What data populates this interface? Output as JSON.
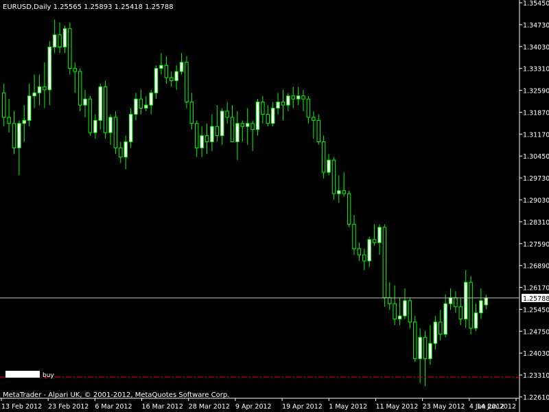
{
  "window": {
    "symbol_info": "EURUSD,Daily  1.25565 1.25893 1.25418 1.25788",
    "copyright": "MetaTrader - Alpari UK, © 2001-2012, MetaQuotes Software Corp."
  },
  "colors": {
    "background": "#000000",
    "bull_candle": "#ffffff",
    "bear_candle": "#000000",
    "candle_wick": "#00ff00",
    "price_line": "#c0c0c0",
    "order_line": "#ff0000",
    "axis": "#ffffff"
  },
  "chart_data": {
    "type": "candlestick",
    "symbol": "EURUSD",
    "timeframe": "Daily",
    "ylim": [
      1.2255,
      1.3545
    ],
    "y_ticks": [
      "1.35450",
      "1.34730",
      "1.34030",
      "1.33310",
      "1.32590",
      "1.31870",
      "1.31170",
      "1.30450",
      "1.29730",
      "1.29030",
      "1.28310",
      "1.27590",
      "1.26890",
      "1.26170",
      "1.25450",
      "1.24750",
      "1.24030",
      "1.23310",
      "1.22610"
    ],
    "x_ticks": [
      "13 Feb 2012",
      "23 Feb 2012",
      "6 Mar 2012",
      "16 Mar 2012",
      "28 Mar 2012",
      "9 Apr 2012",
      "19 Apr 2012",
      "1 May 2012",
      "11 May 2012",
      "23 May 2012",
      "4 Jun 2012",
      "14 Jun 2012"
    ],
    "current_price": "1.25788",
    "order_line": {
      "label": "buy",
      "price": 1.232
    },
    "candles": [
      {
        "o": 1.325,
        "h": 1.328,
        "l": 1.314,
        "c": 1.317
      },
      {
        "o": 1.317,
        "h": 1.323,
        "l": 1.312,
        "c": 1.315
      },
      {
        "o": 1.315,
        "h": 1.319,
        "l": 1.305,
        "c": 1.307
      },
      {
        "o": 1.307,
        "h": 1.316,
        "l": 1.298,
        "c": 1.315
      },
      {
        "o": 1.315,
        "h": 1.321,
        "l": 1.309,
        "c": 1.316
      },
      {
        "o": 1.316,
        "h": 1.328,
        "l": 1.314,
        "c": 1.324
      },
      {
        "o": 1.324,
        "h": 1.331,
        "l": 1.32,
        "c": 1.325
      },
      {
        "o": 1.325,
        "h": 1.331,
        "l": 1.321,
        "c": 1.327
      },
      {
        "o": 1.327,
        "h": 1.335,
        "l": 1.32,
        "c": 1.326
      },
      {
        "o": 1.326,
        "h": 1.342,
        "l": 1.321,
        "c": 1.34
      },
      {
        "o": 1.34,
        "h": 1.349,
        "l": 1.338,
        "c": 1.344
      },
      {
        "o": 1.344,
        "h": 1.348,
        "l": 1.338,
        "c": 1.34
      },
      {
        "o": 1.34,
        "h": 1.347,
        "l": 1.338,
        "c": 1.346
      },
      {
        "o": 1.346,
        "h": 1.348,
        "l": 1.331,
        "c": 1.333
      },
      {
        "o": 1.333,
        "h": 1.335,
        "l": 1.325,
        "c": 1.332
      },
      {
        "o": 1.332,
        "h": 1.333,
        "l": 1.319,
        "c": 1.321
      },
      {
        "o": 1.321,
        "h": 1.326,
        "l": 1.317,
        "c": 1.323
      },
      {
        "o": 1.323,
        "h": 1.324,
        "l": 1.311,
        "c": 1.312
      },
      {
        "o": 1.312,
        "h": 1.318,
        "l": 1.31,
        "c": 1.316
      },
      {
        "o": 1.316,
        "h": 1.328,
        "l": 1.313,
        "c": 1.327
      },
      {
        "o": 1.327,
        "h": 1.329,
        "l": 1.31,
        "c": 1.312
      },
      {
        "o": 1.312,
        "h": 1.318,
        "l": 1.308,
        "c": 1.317
      },
      {
        "o": 1.317,
        "h": 1.319,
        "l": 1.305,
        "c": 1.307
      },
      {
        "o": 1.307,
        "h": 1.309,
        "l": 1.302,
        "c": 1.304
      },
      {
        "o": 1.304,
        "h": 1.311,
        "l": 1.3,
        "c": 1.309
      },
      {
        "o": 1.309,
        "h": 1.32,
        "l": 1.307,
        "c": 1.318
      },
      {
        "o": 1.318,
        "h": 1.325,
        "l": 1.316,
        "c": 1.323
      },
      {
        "o": 1.323,
        "h": 1.326,
        "l": 1.318,
        "c": 1.32
      },
      {
        "o": 1.32,
        "h": 1.324,
        "l": 1.319,
        "c": 1.321
      },
      {
        "o": 1.321,
        "h": 1.326,
        "l": 1.318,
        "c": 1.325
      },
      {
        "o": 1.325,
        "h": 1.334,
        "l": 1.323,
        "c": 1.333
      },
      {
        "o": 1.333,
        "h": 1.338,
        "l": 1.331,
        "c": 1.334
      },
      {
        "o": 1.334,
        "h": 1.337,
        "l": 1.328,
        "c": 1.33
      },
      {
        "o": 1.33,
        "h": 1.332,
        "l": 1.327,
        "c": 1.329
      },
      {
        "o": 1.329,
        "h": 1.334,
        "l": 1.326,
        "c": 1.332
      },
      {
        "o": 1.332,
        "h": 1.338,
        "l": 1.331,
        "c": 1.335
      },
      {
        "o": 1.335,
        "h": 1.337,
        "l": 1.32,
        "c": 1.322
      },
      {
        "o": 1.322,
        "h": 1.325,
        "l": 1.313,
        "c": 1.315
      },
      {
        "o": 1.315,
        "h": 1.316,
        "l": 1.304,
        "c": 1.307
      },
      {
        "o": 1.307,
        "h": 1.314,
        "l": 1.304,
        "c": 1.311
      },
      {
        "o": 1.311,
        "h": 1.315,
        "l": 1.305,
        "c": 1.309
      },
      {
        "o": 1.309,
        "h": 1.318,
        "l": 1.306,
        "c": 1.314
      },
      {
        "o": 1.314,
        "h": 1.321,
        "l": 1.309,
        "c": 1.311
      },
      {
        "o": 1.311,
        "h": 1.32,
        "l": 1.308,
        "c": 1.319
      },
      {
        "o": 1.319,
        "h": 1.322,
        "l": 1.315,
        "c": 1.317
      },
      {
        "o": 1.317,
        "h": 1.321,
        "l": 1.309,
        "c": 1.309
      },
      {
        "o": 1.309,
        "h": 1.319,
        "l": 1.303,
        "c": 1.315
      },
      {
        "o": 1.315,
        "h": 1.316,
        "l": 1.309,
        "c": 1.314
      },
      {
        "o": 1.314,
        "h": 1.32,
        "l": 1.308,
        "c": 1.315
      },
      {
        "o": 1.315,
        "h": 1.316,
        "l": 1.306,
        "c": 1.313
      },
      {
        "o": 1.313,
        "h": 1.323,
        "l": 1.311,
        "c": 1.322
      },
      {
        "o": 1.322,
        "h": 1.324,
        "l": 1.315,
        "c": 1.318
      },
      {
        "o": 1.318,
        "h": 1.321,
        "l": 1.314,
        "c": 1.315
      },
      {
        "o": 1.315,
        "h": 1.322,
        "l": 1.314,
        "c": 1.32
      },
      {
        "o": 1.32,
        "h": 1.325,
        "l": 1.318,
        "c": 1.322
      },
      {
        "o": 1.322,
        "h": 1.326,
        "l": 1.316,
        "c": 1.321
      },
      {
        "o": 1.321,
        "h": 1.325,
        "l": 1.319,
        "c": 1.324
      },
      {
        "o": 1.324,
        "h": 1.327,
        "l": 1.32,
        "c": 1.323
      },
      {
        "o": 1.323,
        "h": 1.327,
        "l": 1.321,
        "c": 1.324
      },
      {
        "o": 1.324,
        "h": 1.326,
        "l": 1.319,
        "c": 1.323
      },
      {
        "o": 1.323,
        "h": 1.324,
        "l": 1.315,
        "c": 1.317
      },
      {
        "o": 1.317,
        "h": 1.319,
        "l": 1.31,
        "c": 1.316
      },
      {
        "o": 1.316,
        "h": 1.318,
        "l": 1.308,
        "c": 1.309
      },
      {
        "o": 1.309,
        "h": 1.311,
        "l": 1.297,
        "c": 1.299
      },
      {
        "o": 1.299,
        "h": 1.305,
        "l": 1.298,
        "c": 1.303
      },
      {
        "o": 1.303,
        "h": 1.304,
        "l": 1.29,
        "c": 1.292
      },
      {
        "o": 1.292,
        "h": 1.298,
        "l": 1.289,
        "c": 1.293
      },
      {
        "o": 1.293,
        "h": 1.299,
        "l": 1.291,
        "c": 1.292
      },
      {
        "o": 1.292,
        "h": 1.293,
        "l": 1.281,
        "c": 1.282
      },
      {
        "o": 1.282,
        "h": 1.285,
        "l": 1.272,
        "c": 1.274
      },
      {
        "o": 1.274,
        "h": 1.276,
        "l": 1.27,
        "c": 1.272
      },
      {
        "o": 1.272,
        "h": 1.274,
        "l": 1.267,
        "c": 1.27
      },
      {
        "o": 1.27,
        "h": 1.278,
        "l": 1.268,
        "c": 1.277
      },
      {
        "o": 1.277,
        "h": 1.282,
        "l": 1.275,
        "c": 1.276
      },
      {
        "o": 1.276,
        "h": 1.282,
        "l": 1.272,
        "c": 1.281
      },
      {
        "o": 1.281,
        "h": 1.282,
        "l": 1.255,
        "c": 1.258
      },
      {
        "o": 1.258,
        "h": 1.263,
        "l": 1.254,
        "c": 1.256
      },
      {
        "o": 1.256,
        "h": 1.262,
        "l": 1.249,
        "c": 1.251
      },
      {
        "o": 1.251,
        "h": 1.258,
        "l": 1.249,
        "c": 1.252
      },
      {
        "o": 1.252,
        "h": 1.261,
        "l": 1.251,
        "c": 1.257
      },
      {
        "o": 1.257,
        "h": 1.258,
        "l": 1.248,
        "c": 1.25
      },
      {
        "o": 1.25,
        "h": 1.252,
        "l": 1.237,
        "c": 1.238
      },
      {
        "o": 1.238,
        "h": 1.248,
        "l": 1.23,
        "c": 1.245
      },
      {
        "o": 1.245,
        "h": 1.247,
        "l": 1.229,
        "c": 1.238
      },
      {
        "o": 1.238,
        "h": 1.249,
        "l": 1.236,
        "c": 1.243
      },
      {
        "o": 1.243,
        "h": 1.252,
        "l": 1.241,
        "c": 1.25
      },
      {
        "o": 1.25,
        "h": 1.254,
        "l": 1.244,
        "c": 1.246
      },
      {
        "o": 1.246,
        "h": 1.259,
        "l": 1.245,
        "c": 1.256
      },
      {
        "o": 1.256,
        "h": 1.261,
        "l": 1.254,
        "c": 1.258
      },
      {
        "o": 1.258,
        "h": 1.26,
        "l": 1.253,
        "c": 1.255
      },
      {
        "o": 1.255,
        "h": 1.258,
        "l": 1.249,
        "c": 1.251
      },
      {
        "o": 1.251,
        "h": 1.267,
        "l": 1.248,
        "c": 1.263
      },
      {
        "o": 1.263,
        "h": 1.265,
        "l": 1.246,
        "c": 1.248
      },
      {
        "o": 1.248,
        "h": 1.256,
        "l": 1.247,
        "c": 1.253
      },
      {
        "o": 1.253,
        "h": 1.261,
        "l": 1.251,
        "c": 1.257
      },
      {
        "o": 1.2556,
        "h": 1.2589,
        "l": 1.2542,
        "c": 1.2579
      }
    ]
  }
}
